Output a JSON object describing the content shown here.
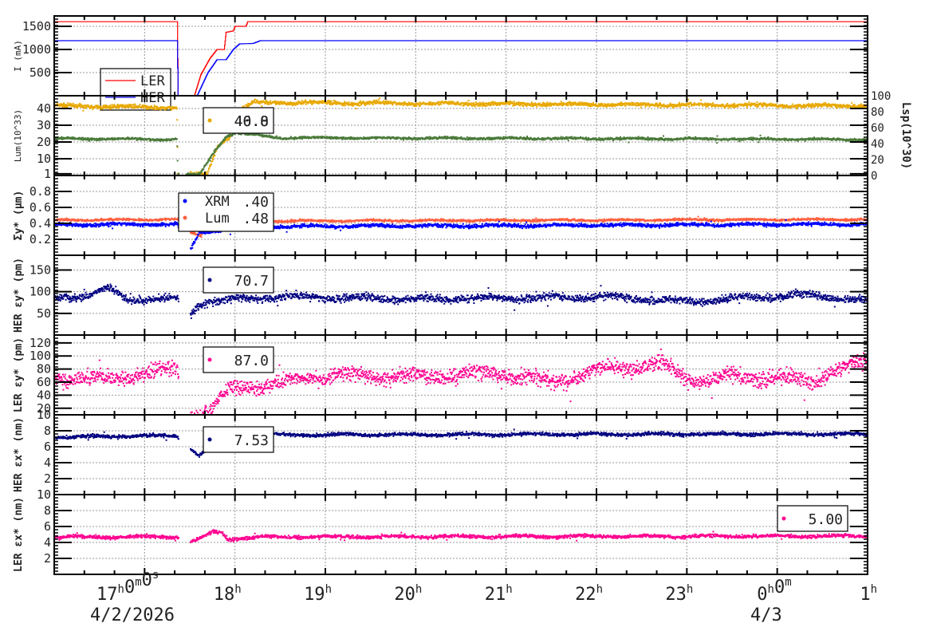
{
  "chart_data": {
    "type": "scatter",
    "x_unit": "hours since 4/2/2026 00:00",
    "xlim": [
      16.0,
      25.0
    ],
    "x_ticks": [
      {
        "t": 17,
        "label": "17",
        "parts": [
          [
            "17",
            "h"
          ],
          [
            "0",
            "m"
          ],
          [
            "0",
            "s"
          ]
        ],
        "date": "4/2/2026"
      },
      {
        "t": 18,
        "parts": [
          [
            "18",
            "h"
          ]
        ]
      },
      {
        "t": 19,
        "parts": [
          [
            "19",
            "h"
          ]
        ]
      },
      {
        "t": 20,
        "parts": [
          [
            "20",
            "h"
          ]
        ]
      },
      {
        "t": 21,
        "parts": [
          [
            "21",
            "h"
          ]
        ]
      },
      {
        "t": 22,
        "parts": [
          [
            "22",
            "h"
          ]
        ]
      },
      {
        "t": 23,
        "parts": [
          [
            "23",
            "h"
          ]
        ]
      },
      {
        "t": 24,
        "parts": [
          [
            "0",
            "h"
          ],
          [
            "0",
            "m"
          ]
        ],
        "date": "4/3"
      },
      {
        "t": 25,
        "parts": [
          [
            "1",
            "h"
          ]
        ]
      }
    ],
    "panels": [
      {
        "ylabel": "I (mA)",
        "ylim": [
          0,
          1724
        ],
        "yticks": [
          500,
          1000,
          1500
        ],
        "style": "line",
        "legend": {
          "entries": [
            {
              "label": "LER",
              "color": "#ff0000"
            },
            {
              "label": "HER",
              "color": "#0000ff"
            }
          ]
        },
        "series": [
          {
            "name": "LER",
            "color": "#ff0000",
            "knots": [
              [
                16,
                1600
              ],
              [
                17.36,
                1600
              ],
              [
                17.37,
                0
              ],
              [
                17.55,
                0
              ],
              [
                17.62,
                450
              ],
              [
                17.72,
                800
              ],
              [
                17.8,
                1000
              ],
              [
                17.88,
                1000
              ],
              [
                17.9,
                1370
              ],
              [
                17.98,
                1400
              ],
              [
                18.0,
                1500
              ],
              [
                18.12,
                1500
              ],
              [
                18.14,
                1600
              ],
              [
                25,
                1600
              ]
            ],
            "noise": 0
          },
          {
            "name": "HER",
            "color": "#0000ff",
            "knots": [
              [
                16,
                1190
              ],
              [
                17.36,
                1190
              ],
              [
                17.37,
                0
              ],
              [
                17.58,
                0
              ],
              [
                17.7,
                500
              ],
              [
                17.8,
                780
              ],
              [
                17.9,
                780
              ],
              [
                17.98,
                1000
              ],
              [
                18.05,
                1120
              ],
              [
                18.2,
                1130
              ],
              [
                18.28,
                1190
              ],
              [
                25,
                1190
              ]
            ],
            "noise": 0
          }
        ]
      },
      {
        "ylabel": "Lum(10^33)",
        "ylim": [
          0,
          47.6
        ],
        "yticks": [
          1,
          10,
          20,
          30,
          40
        ],
        "ytick_labels": [
          "1",
          "10",
          "20",
          "30",
          "40"
        ],
        "style": "dots",
        "right_axis": {
          "label": "Lsp(10^30)",
          "ylim": [
            0,
            100
          ],
          "ticks": [
            0,
            20,
            40,
            60,
            80,
            100
          ]
        },
        "legend": {
          "entries": [
            {
              "label": "",
              "value": "40.8",
              "color": "#e8a800"
            },
            {
              "label": "",
              "value": "46.0",
              "color": "#e8a800"
            }
          ]
        },
        "series": [
          {
            "name": "Lum",
            "color": "#e8a800",
            "knots": [
              [
                16,
                42
              ],
              [
                17.35,
                41
              ],
              [
                17.36,
                1
              ],
              [
                17.68,
                1
              ],
              [
                17.8,
                18
              ],
              [
                17.95,
                25
              ],
              [
                18.0,
                38
              ],
              [
                18.2,
                44
              ],
              [
                25,
                42
              ]
            ],
            "noise": 0.8
          },
          {
            "name": "Lsp",
            "color": "#4a7a3a",
            "knots": [
              [
                16,
                22.5
              ],
              [
                17.35,
                22
              ],
              [
                17.36,
                1
              ],
              [
                17.6,
                1
              ],
              [
                17.75,
                14
              ],
              [
                17.9,
                24
              ],
              [
                18.0,
                26
              ],
              [
                18.5,
                23
              ],
              [
                25,
                22
              ]
            ],
            "noise": 0.5
          }
        ]
      },
      {
        "ylabel": "Σy* (µm)",
        "ylim": [
          0,
          1.0
        ],
        "yticks": [
          0.2,
          0.4,
          0.6,
          0.8
        ],
        "ytick_labels": [
          "0.2",
          "0.4",
          "0.6",
          "0.8"
        ],
        "style": "dots",
        "legend": {
          "entries": [
            {
              "label": "XRM",
              "value": ".40",
              "color": "#0000ff"
            },
            {
              "label": "Lum",
              "value": ".48",
              "color": "#ff6040"
            }
          ]
        },
        "series": [
          {
            "name": "Lum",
            "color": "#ff6040",
            "knots": [
              [
                16,
                0.45
              ],
              [
                17.35,
                0.46
              ],
              [
                17.5,
                0.3
              ],
              [
                17.62,
                0.25
              ],
              [
                17.7,
                0.6
              ],
              [
                17.85,
                0.42
              ],
              [
                18.2,
                0.44
              ],
              [
                25,
                0.46
              ]
            ],
            "noise": 0.01
          },
          {
            "name": "XRM",
            "color": "#0000ff",
            "knots": [
              [
                16,
                0.39
              ],
              [
                17.35,
                0.4
              ],
              [
                17.5,
                0.08
              ],
              [
                17.6,
                0.3
              ],
              [
                17.8,
                0.32
              ],
              [
                18.2,
                0.37
              ],
              [
                25,
                0.4
              ]
            ],
            "noise": 0.015
          }
        ]
      },
      {
        "ylabel": "HER εy* (pm)",
        "ylim": [
          0,
          184
        ],
        "yticks": [
          50,
          100,
          150
        ],
        "style": "dots",
        "legend": {
          "entries": [
            {
              "label": "",
              "value": "70.7",
              "color": "#000080"
            }
          ]
        },
        "series": [
          {
            "name": "HER εy*",
            "color": "#000080",
            "knots": [
              [
                16,
                85
              ],
              [
                16.4,
                95
              ],
              [
                16.6,
                110
              ],
              [
                16.8,
                85
              ],
              [
                17.35,
                85
              ],
              [
                17.5,
                50
              ],
              [
                17.6,
                75
              ],
              [
                17.7,
                80
              ],
              [
                18.5,
                90
              ],
              [
                20,
                85
              ],
              [
                22,
                90
              ],
              [
                23,
                80
              ],
              [
                24.3,
                95
              ],
              [
                25,
                80
              ]
            ],
            "noise": 6
          }
        ]
      },
      {
        "ylabel": "LER εy* (pm)",
        "ylim": [
          10,
          132
        ],
        "yticks": [
          10,
          20,
          40,
          60,
          80,
          100,
          120
        ],
        "style": "dots",
        "legend": {
          "entries": [
            {
              "label": "",
              "value": "87.0",
              "color": "#ff0090"
            }
          ]
        },
        "series": [
          {
            "name": "LER εy*",
            "color": "#ff0090",
            "knots": [
              [
                16,
                70
              ],
              [
                16.6,
                65
              ],
              [
                17,
                75
              ],
              [
                17.35,
                80
              ],
              [
                17.5,
                14
              ],
              [
                17.7,
                14
              ],
              [
                17.85,
                38
              ],
              [
                18,
                52
              ],
              [
                18.5,
                60
              ],
              [
                19,
                72
              ],
              [
                20,
                70
              ],
              [
                21,
                75
              ],
              [
                21.5,
                60
              ],
              [
                22,
                80
              ],
              [
                22.7,
                90
              ],
              [
                23,
                65
              ],
              [
                24,
                70
              ],
              [
                24.4,
                60
              ],
              [
                24.6,
                80
              ],
              [
                25,
                90
              ]
            ],
            "noise": 8
          }
        ]
      },
      {
        "ylabel": "HER εx* (nm)",
        "ylim": [
          0,
          10
        ],
        "yticks": [
          2,
          4,
          6,
          8
        ],
        "style": "dots",
        "legend": {
          "entries": [
            {
              "label": "",
              "value": "7.53",
              "color": "#000080"
            }
          ]
        },
        "series": [
          {
            "name": "HER εx*",
            "color": "#000080",
            "knots": [
              [
                16,
                7.3
              ],
              [
                17.35,
                7.5
              ],
              [
                17.5,
                5.8
              ],
              [
                17.6,
                5.0
              ],
              [
                17.75,
                6.4
              ],
              [
                17.9,
                6.6
              ],
              [
                18.0,
                7.3
              ],
              [
                18.3,
                7.6
              ],
              [
                25,
                7.7
              ]
            ],
            "noise": 0.15
          }
        ]
      },
      {
        "ylabel": "LER εx* (nm)",
        "ylim": [
          0,
          10
        ],
        "yticks": [
          2,
          4,
          6,
          8,
          10
        ],
        "style": "dots",
        "legend": {
          "entries": [
            {
              "label": "",
              "value": "5.00",
              "color": "#ff0090"
            }
          ]
        },
        "series": [
          {
            "name": "LER εx*",
            "color": "#ff0090",
            "knots": [
              [
                16,
                4.8
              ],
              [
                17.35,
                4.8
              ],
              [
                17.5,
                4.2
              ],
              [
                17.6,
                4.5
              ],
              [
                17.75,
                5.4
              ],
              [
                17.85,
                5.3
              ],
              [
                17.9,
                4.5
              ],
              [
                18.3,
                4.8
              ],
              [
                25,
                4.9
              ]
            ],
            "noise": 0.15
          }
        ]
      }
    ]
  }
}
